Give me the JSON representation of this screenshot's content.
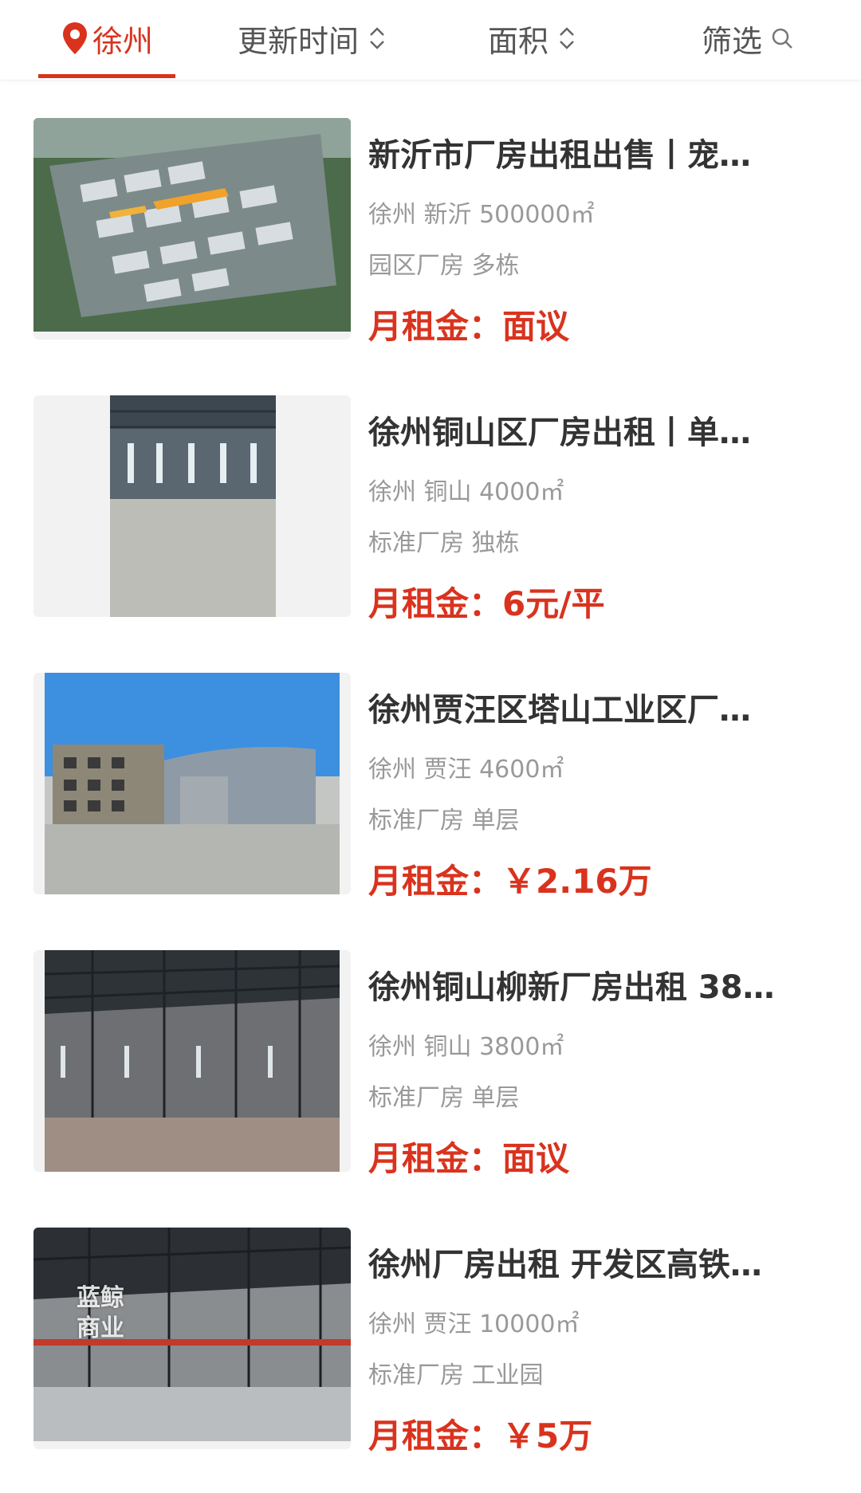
{
  "accent_color": "#d9331e",
  "filter_bar": {
    "city": "徐州",
    "sort_time": "更新时间",
    "sort_area": "面积",
    "filter": "筛选"
  },
  "listings": [
    {
      "title": "新沂市厂房出租出售丨宠…",
      "meta": "徐州 新沂 500000㎡",
      "tags": "园区厂房 多栋",
      "price_label": "月租金：",
      "price": "面议",
      "image": "industrial-park-aerial-photo"
    },
    {
      "title": "徐州铜山区厂房出租丨单…",
      "meta": "徐州 铜山 4000㎡",
      "tags": "标准厂房 独栋",
      "price_label": "月租金：",
      "price": "6元/平",
      "image": "warehouse-interior-photo"
    },
    {
      "title": "徐州贾汪区塔山工业区厂…",
      "meta": "徐州 贾汪 4600㎡",
      "tags": "标准厂房 单层",
      "price_label": "月租金：",
      "price": "￥2.16万",
      "image": "factory-exterior-photo"
    },
    {
      "title": "徐州铜山柳新厂房出租 38…",
      "meta": "徐州 铜山 3800㎡",
      "tags": "标准厂房 单层",
      "price_label": "月租金：",
      "price": "面议",
      "image": "steel-frame-workshop-photo"
    },
    {
      "title": "徐州厂房出租 开发区高铁…",
      "meta": "徐州 贾汪 10000㎡",
      "tags": "标准厂房 工业园",
      "price_label": "月租金：",
      "price": "￥5万",
      "image": "crane-workshop-photo",
      "watermark": "蓝鲸 商业"
    }
  ]
}
